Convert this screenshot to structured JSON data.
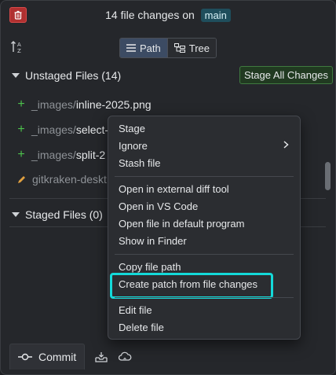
{
  "header": {
    "title": "14 file changes on",
    "branch": "main"
  },
  "view_toggle": {
    "path_label": "Path",
    "tree_label": "Tree",
    "selected": "Path"
  },
  "unstaged": {
    "title": "Unstaged Files (14)",
    "stage_all_label": "Stage All Changes",
    "files": [
      {
        "status": "added",
        "dir": "_images/",
        "name": "inline-2025.png"
      },
      {
        "status": "added",
        "dir": "_images/",
        "name": "select-"
      },
      {
        "status": "added",
        "dir": "_images/",
        "name": "split-2"
      },
      {
        "status": "modified",
        "dir": "",
        "name": "gitkraken-deskt"
      }
    ]
  },
  "staged": {
    "title": "Staged Files (0)"
  },
  "context_menu": {
    "items": [
      "Stage",
      "Ignore",
      "Stash file",
      "Open in external diff tool",
      "Open in VS Code",
      "Open file in default program",
      "Show in Finder",
      "Copy file path",
      "Create patch from file changes",
      "Edit file",
      "Delete file"
    ],
    "highlighted": "Create patch from file changes",
    "highlight_color": "#14d9d9"
  },
  "bottom_tabs": {
    "commit_label": "Commit"
  },
  "colors": {
    "added": "#4cc14c",
    "modified": "#e0a040",
    "branch_bg": "#1f4e5c",
    "stage_all_border": "#3f7a3f"
  }
}
